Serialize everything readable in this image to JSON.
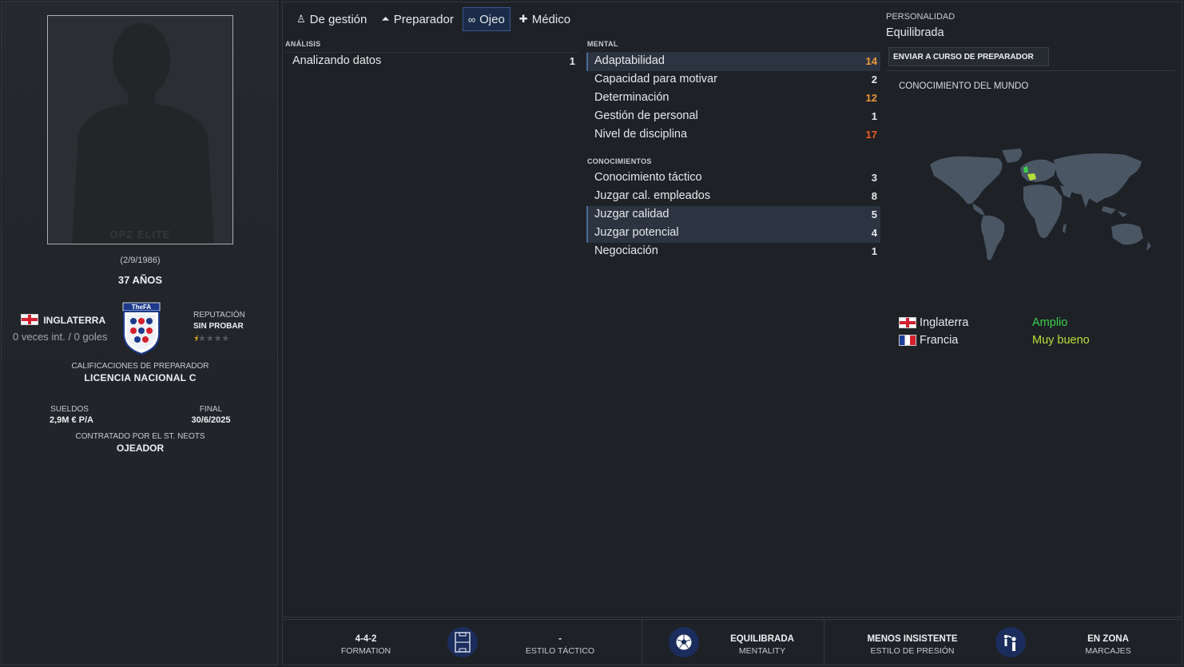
{
  "profile": {
    "photo_watermark": "OPZ ELITE",
    "dob": "(2/9/1986)",
    "age": "37 AÑOS",
    "nation": "INGLATERRA",
    "caps": "0 veces int. / 0 goles",
    "badge_text": "TheFA",
    "reputation_label": "REPUTACIÓN",
    "reputation_value": "SIN PROBAR",
    "reputation_stars": 0.5,
    "qualification_label": "CALIFICACIONES DE PREPARADOR",
    "qualification_value": "LICENCIA NACIONAL C",
    "wage_label": "SUELDOS",
    "wage_value": "2,9M € P/A",
    "end_label": "FINAL",
    "end_value": "30/6/2025",
    "contract_label": "CONTRATADO POR EL ST. NEOTS",
    "contract_value": "OJEADOR"
  },
  "tabs": [
    {
      "label": "De gestión",
      "icon": "person-tie-icon",
      "glyph": "♙",
      "active": false
    },
    {
      "label": "Preparador",
      "icon": "cone-icon",
      "glyph": "⏶",
      "active": false
    },
    {
      "label": "Ojeo",
      "icon": "binoculars-icon",
      "glyph": "∞",
      "active": true
    },
    {
      "label": "Médico",
      "icon": "medical-kit-icon",
      "glyph": "✚",
      "active": false
    }
  ],
  "analysis": {
    "label": "ANÁLISIS",
    "items": [
      {
        "name": "Analizando datos",
        "value": "1",
        "tone": "normal",
        "highlight": false
      }
    ]
  },
  "mental": {
    "label": "MENTAL",
    "items": [
      {
        "name": "Adaptabilidad",
        "value": "14",
        "tone": "orange",
        "highlight": true
      },
      {
        "name": "Capacidad para motivar",
        "value": "2",
        "tone": "normal",
        "highlight": false
      },
      {
        "name": "Determinación",
        "value": "12",
        "tone": "orange",
        "highlight": false
      },
      {
        "name": "Gestión de personal",
        "value": "1",
        "tone": "normal",
        "highlight": false
      },
      {
        "name": "Nivel de disciplina",
        "value": "17",
        "tone": "red",
        "highlight": false
      }
    ]
  },
  "knowledge": {
    "label": "CONOCIMIENTOS",
    "items": [
      {
        "name": "Conocimiento táctico",
        "value": "3",
        "tone": "normal",
        "highlight": false
      },
      {
        "name": "Juzgar cal. empleados",
        "value": "8",
        "tone": "normal",
        "highlight": false
      },
      {
        "name": "Juzgar calidad",
        "value": "5",
        "tone": "normal",
        "highlight": true
      },
      {
        "name": "Juzgar potencial",
        "value": "4",
        "tone": "normal",
        "highlight": true
      },
      {
        "name": "Negociación",
        "value": "1",
        "tone": "normal",
        "highlight": false
      }
    ]
  },
  "personality": {
    "label": "PERSONALIDAD",
    "value": "Equilibrada",
    "course_button": "ENVIAR A CURSO DE PREPARADOR"
  },
  "world": {
    "title": "CONOCIMIENTO DEL MUNDO",
    "languages": [
      {
        "country": "Inglaterra",
        "flag": "england-flag",
        "level": "Amplio",
        "color": "#3bd04c"
      },
      {
        "country": "Francia",
        "flag": "france-flag",
        "level": "Muy bueno",
        "color": "#b5e03a"
      }
    ]
  },
  "bottom": {
    "formation_value": "4-4-2",
    "formation_label": "FORMATION",
    "style_value": "-",
    "style_label": "ESTILO TÁCTICO",
    "mentality_value": "EQUILIBRADA",
    "mentality_label": "MENTALITY",
    "press_value": "MENOS INSISTENTE",
    "press_label": "ESTILO DE PRESIÓN",
    "marking_value": "EN ZONA",
    "marking_label": "MARCAJES"
  },
  "colors": {
    "accent_blue": "#1b2c4a",
    "orange": "#f0973a",
    "red": "#ef5a22",
    "green": "#3bd04c",
    "lime": "#b5e03a"
  }
}
